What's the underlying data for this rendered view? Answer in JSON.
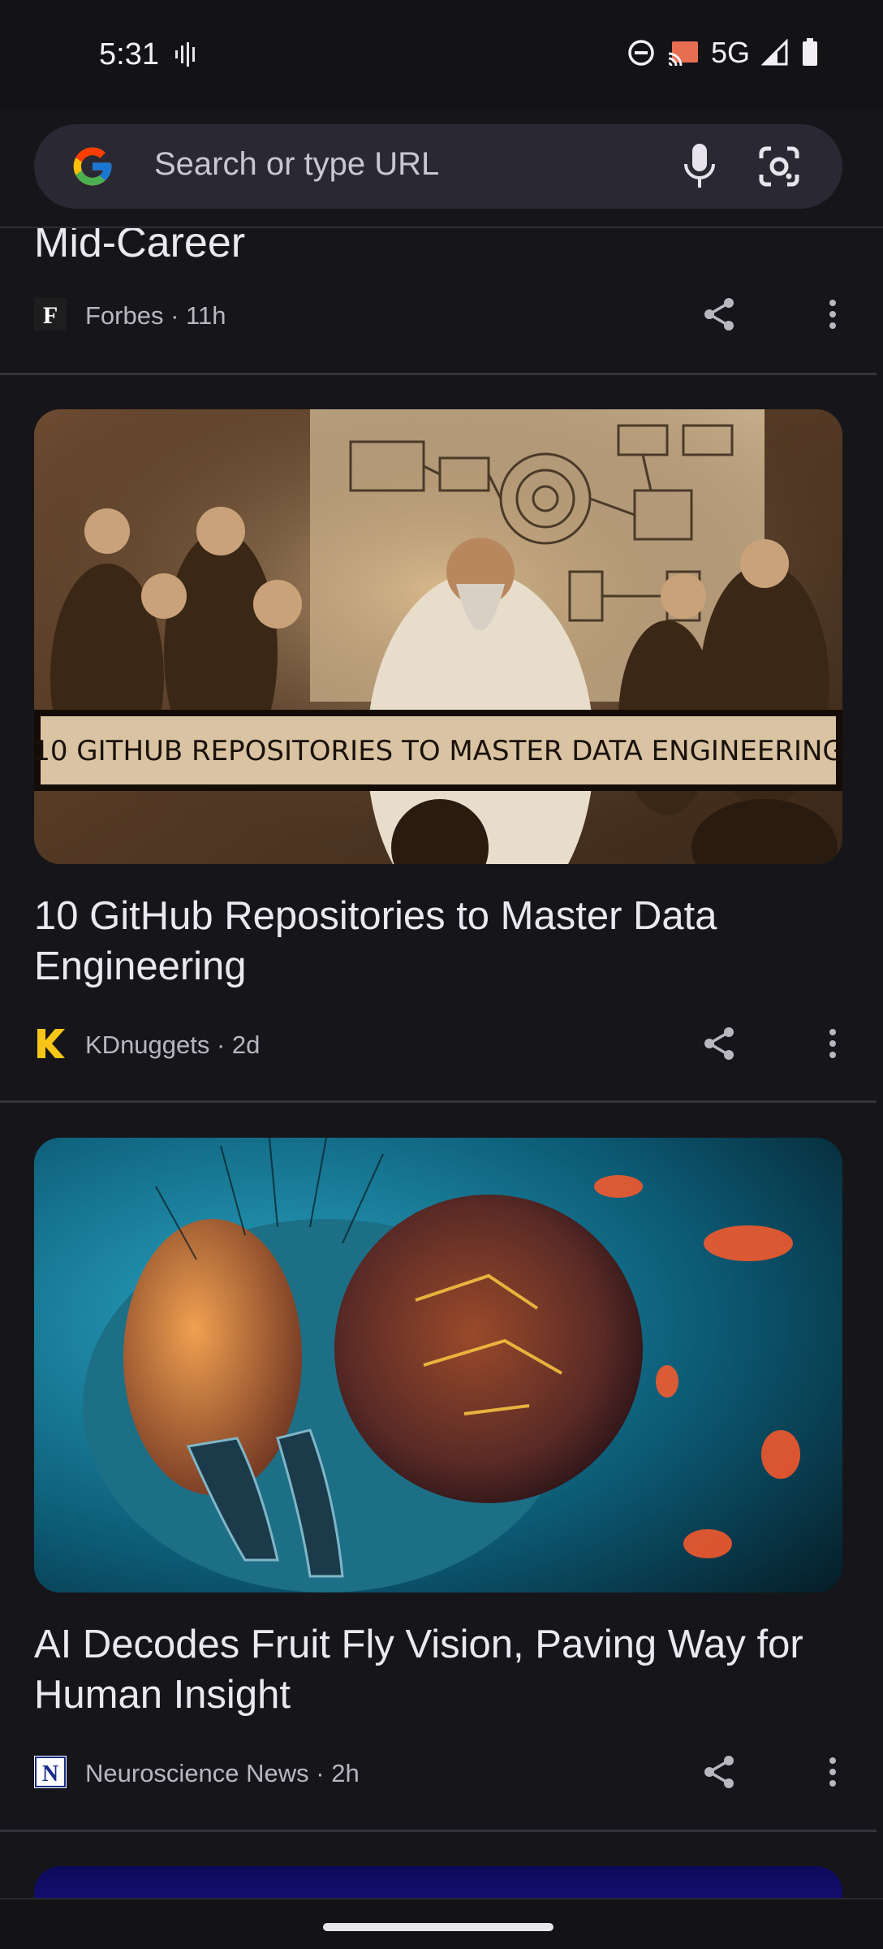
{
  "status_bar": {
    "time": "5:31",
    "network": "5G",
    "icons": [
      "voice-wave-icon",
      "dnd-icon",
      "cast-icon",
      "signal-icon",
      "battery-icon"
    ]
  },
  "search": {
    "placeholder": "Search or type URL",
    "icons": [
      "google-logo",
      "mic-icon",
      "lens-icon"
    ]
  },
  "feed": {
    "top_partial": {
      "title": "Mid-Career",
      "source": "Forbes",
      "age": "11h",
      "source_line": "Forbes · 11h"
    },
    "cards": [
      {
        "title": "10 GitHub Repositories to Master Data Engineering",
        "image_caption": "10 GITHUB REPOSITORIES TO MASTER DATA ENGINEERING",
        "source": "KDnuggets",
        "age": "2d",
        "source_line": "KDnuggets · 2d"
      },
      {
        "title": "AI Decodes Fruit Fly Vision, Paving Way for Human Insight",
        "source": "Neuroscience News",
        "age": "2h",
        "source_line": "Neuroscience News · 2h"
      }
    ]
  },
  "colors": {
    "background": "#16161a",
    "search_bar": "#2a2933",
    "text_primary": "#ebe8ef",
    "text_secondary": "#b9b6c0"
  }
}
